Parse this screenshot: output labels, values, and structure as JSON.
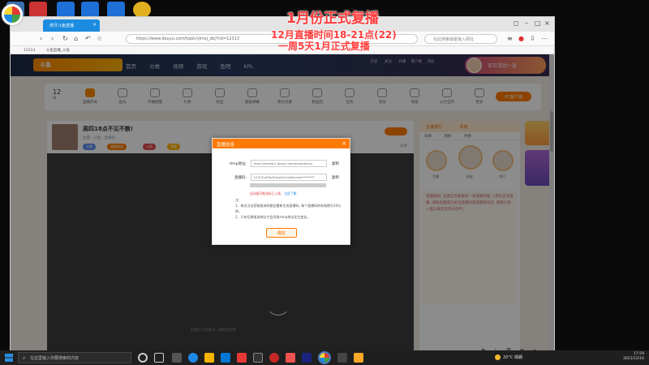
{
  "browser": {
    "tab_title": "虎牙斗鱼直播",
    "url": "https://www.douyu.com/topic/ylmsj_zbj?rid=12313",
    "search_placeholder": "在此搜索或者输入网址",
    "bookmarks": [
      "12313",
      "斗鱼直播_斗鱼"
    ]
  },
  "site": {
    "logo": "斗鱼",
    "nav": [
      "首页",
      "分类",
      "视频",
      "游戏",
      "鱼吧",
      "KPL"
    ],
    "header_icons": [
      "历史",
      "关注",
      "开播",
      "客户端",
      "消息"
    ],
    "header_banner": "百日活动一直"
  },
  "categories": {
    "first": "12",
    "first_sub": "级",
    "items": [
      "直播开关",
      "鱼丸",
      "开播提醒",
      "礼物",
      "粉丝",
      "超级弹幕",
      "积分兑换",
      "粉丝团",
      "任务",
      "活动",
      "等级",
      "火力全开",
      "更多"
    ],
    "pc_button": "PC客户端"
  },
  "room": {
    "title": "周四18点不见不散!",
    "meta": "主播  · 斗鱼  ·  直播间",
    "badges": [
      "主播",
      "超级粉丝",
      "斗鱼",
      "直播"
    ],
    "follow": "关注",
    "share": "分享",
    "loading": "主播正在准备中, 请稍后观看"
  },
  "sidebar": {
    "tabs": [
      "主播排行",
      "贵宾"
    ],
    "subtabs": [
      "日榜",
      "周榜",
      "月榜"
    ],
    "ranks": [
      "主播",
      "粉丝",
      "用户",
      "观众"
    ],
    "notice": "直播通知: 主播正在筹备新一季直播内容, 1月份正式复播, 请粉丝朋友们关注直播间获取最新动态, 感谢大家一直以来的支持与陪伴。"
  },
  "dialog": {
    "title": "直播信息",
    "rtmp_label": "rtmp地址:",
    "rtmp_value": "rtmp://sendtc1.douyu.com/pushdouyu",
    "key_label": "直播码:",
    "key_value": "12313ryE5pHQepGe1xsSecretv********",
    "copy": "复制",
    "red_tip": "自动填写推流码已上线,",
    "red_link": "点此了解",
    "notes_title": "注:",
    "note1": "1、每次点击获取推流码都会重新生成直播码, 每个直播码的有效期为10分钟。",
    "note2": "2、只有切换推流地址才会导致rtmp地址发生变化。",
    "ok": "确定"
  },
  "overlay": {
    "line1": "1月份正式复播",
    "line2": "12月直播时间18-21点(22)",
    "line3": "一周5天1月正式复播"
  },
  "taskbar": {
    "search": "在这里输入你要搜索的内容",
    "weather": "20°C 晴朗",
    "time": "17:59",
    "date": "2021/12/16"
  },
  "colors": {
    "accent": "#ff7a00",
    "overlay_red": "#ff3b3b",
    "tab_blue": "#1b8ce0"
  }
}
